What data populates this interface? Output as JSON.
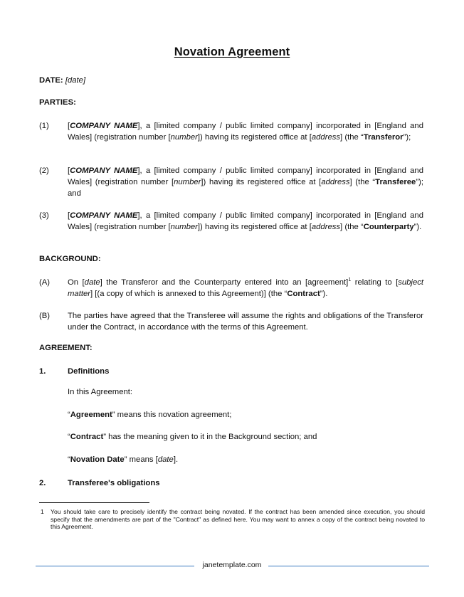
{
  "document": {
    "title": "Novation Agreement",
    "date_label": "DATE:",
    "date_value": "[date]",
    "parties_heading": "PARTIES:",
    "parties": [
      {
        "number": "(1)",
        "company": "COMPANY NAME",
        "text_a": "], a [limited company / public limited company] incorporated in [England and Wales] (registration number [",
        "number_placeholder": "number",
        "text_b": "]) having its registered office at [",
        "address_placeholder": "address",
        "text_c": "] (the “",
        "role": "Transferor",
        "text_d": "”);"
      },
      {
        "number": "(2)",
        "company": "COMPANY NAME",
        "text_a": "], a [limited company / public limited company] incorporated in [England and Wales] (registration number [",
        "number_placeholder": "number",
        "text_b": "]) having its registered office at [",
        "address_placeholder": "address",
        "text_c": "] (the “",
        "role": "Transferee",
        "text_d": "”); and"
      },
      {
        "number": "(3)",
        "company": "COMPANY NAME",
        "text_a": "], a [limited company / public limited company] incorporated in [England and Wales] (registration number [",
        "number_placeholder": "number",
        "text_b": "]) having its registered office at [",
        "address_placeholder": "address",
        "text_c": "] (the “",
        "role": "Counterparty",
        "text_d": "”)."
      }
    ],
    "background_heading": "BACKGROUND:",
    "background": {
      "a": {
        "number": "(A)",
        "t1": "On [",
        "date": "date",
        "t2": "] the Transferor and the Counterparty entered into an [agreement]",
        "footnote_ref": "1",
        "t3": "  relating to [",
        "subject": "subject matter",
        "t4": "] [(a copy of which is annexed to this Agreement)] (the “",
        "defined": "Contract",
        "t5": "”)."
      },
      "b": {
        "number": "(B)",
        "text": "The parties have agreed that the Transferee will assume the rights and obligations of the Transferor under the Contract, in accordance with the terms of this Agreement."
      }
    },
    "agreement_heading": "AGREEMENT:",
    "clause1": {
      "number": "1.",
      "heading": "Definitions",
      "intro": "In this Agreement:",
      "definitions": [
        {
          "open": "“",
          "term": "Agreement",
          "rest": "” means this novation agreement;"
        },
        {
          "open": "“",
          "term": "Contract",
          "rest": "” has the meaning given to it in the Background section; and"
        },
        {
          "open": "“",
          "term": "Novation Date",
          "rest": "” means [",
          "placeholder": "date",
          "tail": "]."
        }
      ]
    },
    "clause2": {
      "number": "2.",
      "heading": "Transferee's obligations"
    },
    "footnote": {
      "number": "1",
      "text": "You should take care to precisely identify the contract being novated.  If the contract has been amended since execution, you should specify that the amendments are part of the \"Contract\" as defined here. You may want to annex a copy of the contract being novated to this Agreement."
    },
    "footer": {
      "site": "janetemplate.com",
      "line_color": "#3a78c0"
    }
  }
}
